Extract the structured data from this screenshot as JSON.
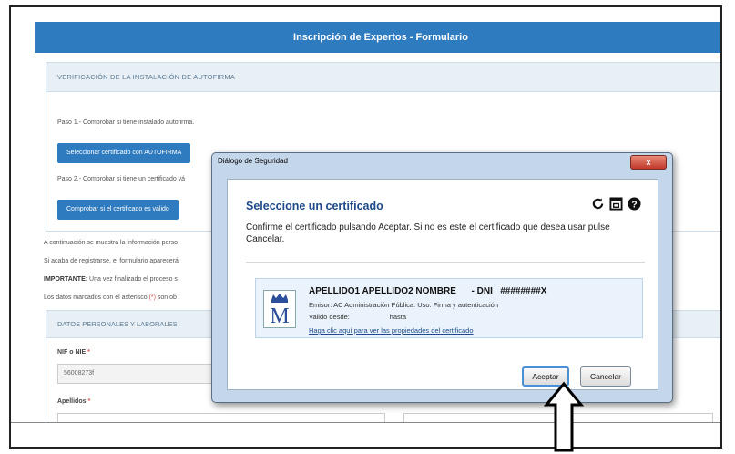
{
  "header": {
    "title": "Inscripción de Expertos - Formulario"
  },
  "verification": {
    "heading": "VERIFICACIÓN DE LA INSTALACIÓN DE AUTOFIRMA",
    "step1_text": "Paso 1.- Comprobar si tiene instalado autofirma.",
    "step1_button": "Seleccionar certificado con AUTOFIRMA",
    "step2_text": "Paso 2.- Comprobar si tiene un certificado vá",
    "step2_button": "Comprobar si el certificado es válido"
  },
  "info": {
    "line1": "A continuación se muestra la información perso",
    "line2": "Si acaba de registrarse, el formulario aparecerá",
    "line3_bold": "IMPORTANTE:",
    "line3_rest": " Una vez finalizado el proceso s",
    "line4_pre": "Los datos marcados con el asterisco ",
    "line4_red": "(*)",
    "line4_post": " son ob"
  },
  "datos": {
    "heading": "DATOS PERSONALES Y LABORALES",
    "nif_label": "NIF o NIE",
    "nif_req": "*",
    "nif_value": "56008273f",
    "apellidos_label": "Apellidos",
    "apellidos_req": "*"
  },
  "dialog": {
    "title": "Diálogo de Seguridad",
    "close_label": "x",
    "heading": "Seleccione un certificado",
    "message": "Confirme el certificado pulsando Aceptar. Si no es este el certificado que desea usar pulse Cancelar.",
    "icons": [
      "refresh-icon",
      "window-icon",
      "help-icon"
    ],
    "certificate": {
      "name": "APELLIDO1 APELLIDO2 NOMBRE      - DNI   ########X",
      "issuer": "Emisor: AC Administración Pública. Uso: Firma y autenticación",
      "validity": "Valido desde:                     hasta",
      "link": "Haga clic aquí para ver las propiedades del certificado"
    },
    "accept_label": "Aceptar",
    "cancel_label": "Cancelar"
  },
  "colors": {
    "accent": "#2f7bbf",
    "dialog_heading": "#1d4a8a",
    "required": "#d9534f"
  }
}
